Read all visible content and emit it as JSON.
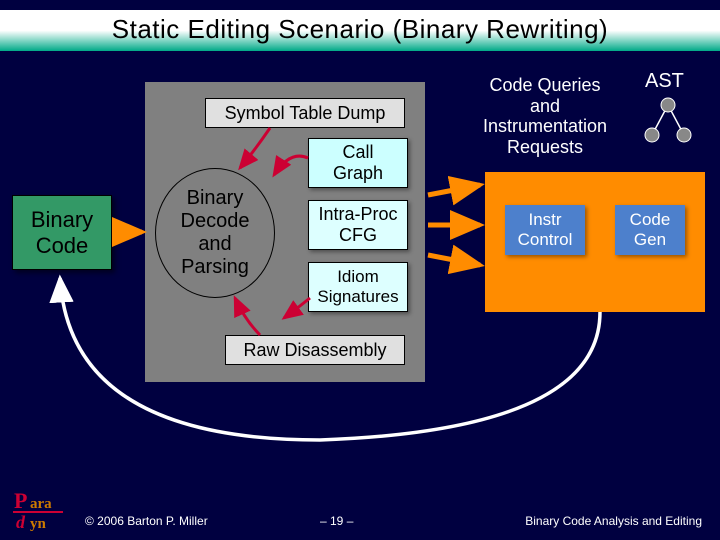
{
  "title": "Static Editing Scenario (Binary Rewriting)",
  "boxes": {
    "binary_code": "Binary\nCode",
    "symbol_dump": "Symbol Table Dump",
    "decode": "Binary\nDecode\nand\nParsing",
    "call_graph": "Call\nGraph",
    "intra_cfg": "Intra-Proc\nCFG",
    "idiom": "Idiom\nSignatures",
    "raw_dis": "Raw Disassembly",
    "instr_control": "Instr\nControl",
    "code_gen": "Code\nGen"
  },
  "labels": {
    "queries": "Code Queries\nand\nInstrumentation\nRequests",
    "ast": "AST"
  },
  "footer": {
    "copyright": "© 2006 Barton P. Miller",
    "page": "– 19 –",
    "right": "Binary Code Analysis and Editing"
  },
  "logo": {
    "top": "ara",
    "bottom": "yn"
  },
  "colors": {
    "bg": "#000040",
    "green": "#339966",
    "orange": "#ff8c00",
    "blue": "#4d80cc",
    "cyan": "#ccffff"
  }
}
